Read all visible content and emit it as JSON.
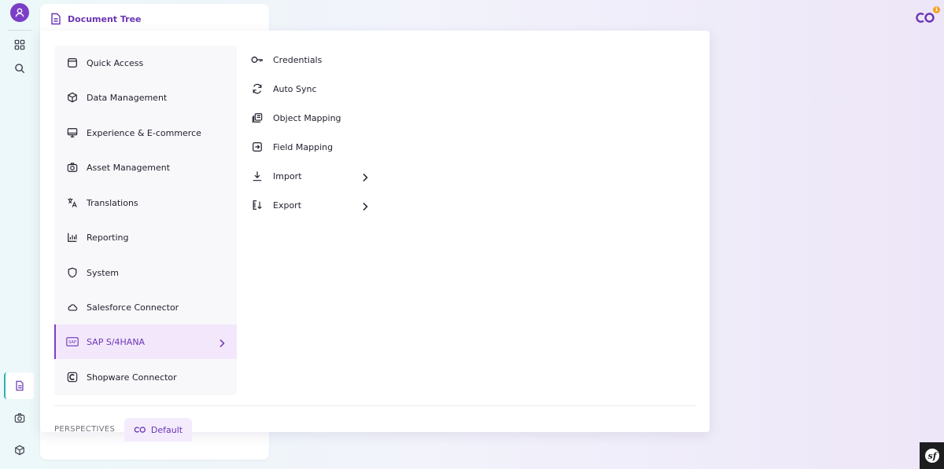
{
  "header": {
    "doc_tree_title": "Document Tree",
    "notification_count": "1"
  },
  "menu": {
    "items": [
      {
        "label": "Quick Access",
        "icon": "window-icon"
      },
      {
        "label": "Data Management",
        "icon": "cube-icon"
      },
      {
        "label": "Experience & E-commerce",
        "icon": "monitor-icon"
      },
      {
        "label": "Asset Management",
        "icon": "camera-icon"
      },
      {
        "label": "Translations",
        "icon": "translate-icon"
      },
      {
        "label": "Reporting",
        "icon": "bar-chart-icon"
      },
      {
        "label": "System",
        "icon": "shield-icon"
      },
      {
        "label": "Salesforce Connector",
        "icon": "cloud-icon"
      },
      {
        "label": "SAP S/4HANA",
        "icon": "sap-icon",
        "active": true
      },
      {
        "label": "Shopware Connector",
        "icon": "shopware-icon"
      }
    ],
    "submenu": [
      {
        "label": "Credentials",
        "icon": "key-icon"
      },
      {
        "label": "Auto Sync",
        "icon": "sync-icon"
      },
      {
        "label": "Object Mapping",
        "icon": "object-mapping-icon"
      },
      {
        "label": "Field Mapping",
        "icon": "field-mapping-icon"
      },
      {
        "label": "Import",
        "icon": "download-icon",
        "has_children": true
      },
      {
        "label": "Export",
        "icon": "export-icon",
        "has_children": true
      }
    ]
  },
  "perspectives": {
    "label": "PERSPECTIVES",
    "current": "Default"
  },
  "colors": {
    "accent": "#7b3fc7",
    "active_bg": "#f3e7fc",
    "rail_accent": "#2bb3b7",
    "badge": "#f4a21b"
  }
}
